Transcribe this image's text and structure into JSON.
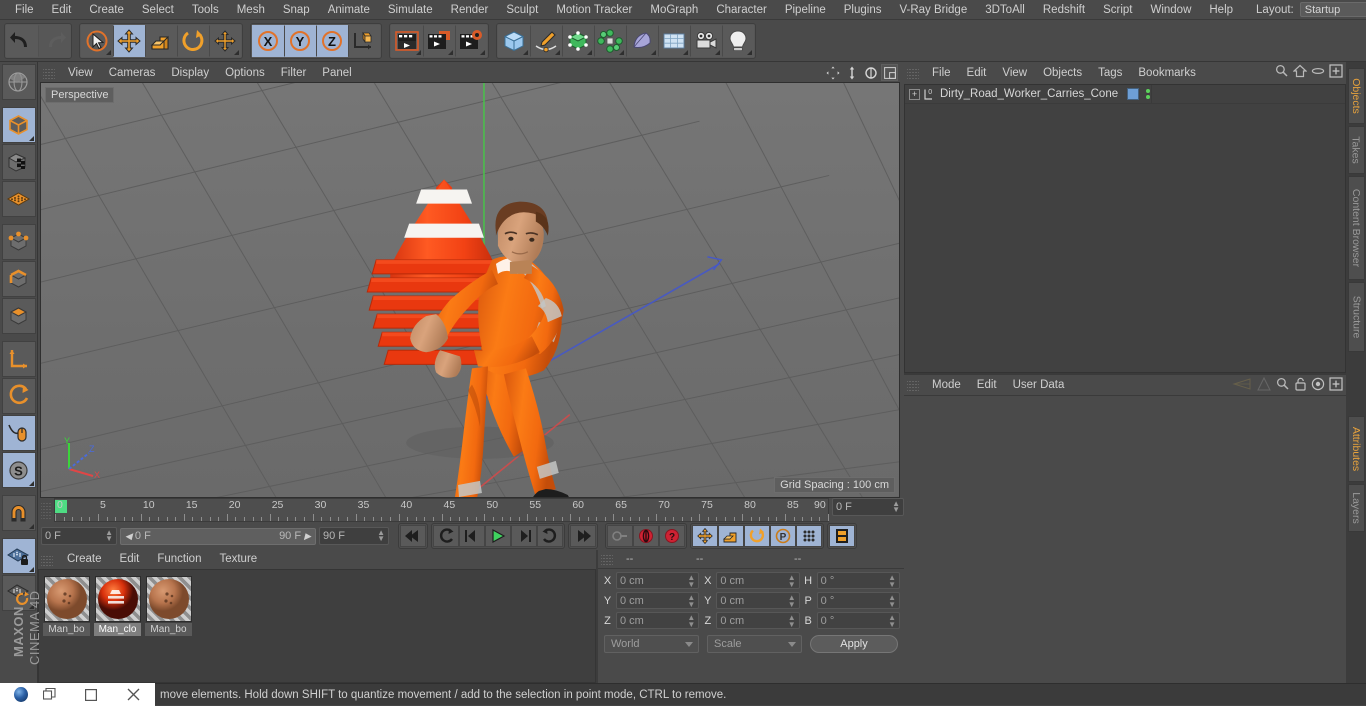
{
  "menubar": {
    "items": [
      "File",
      "Edit",
      "Create",
      "Select",
      "Tools",
      "Mesh",
      "Snap",
      "Animate",
      "Simulate",
      "Render",
      "Sculpt",
      "Motion Tracker",
      "MoGraph",
      "Character",
      "Pipeline",
      "Plugins",
      "V-Ray Bridge",
      "3DToAll",
      "Redshift",
      "Script",
      "Window",
      "Help"
    ],
    "layout_label": "Layout:",
    "layout_value": "Startup"
  },
  "toolbar": {
    "groups": [
      {
        "name": "history",
        "buttons": [
          {
            "icon": "undo-icon",
            "label": "Undo",
            "selected": false,
            "disabled": false
          },
          {
            "icon": "redo-icon",
            "label": "Redo",
            "selected": false,
            "disabled": true
          }
        ]
      },
      {
        "name": "selection-transform",
        "buttons": [
          {
            "icon": "live-selection-icon",
            "label": "Live Selection",
            "selected": false,
            "disabled": false
          },
          {
            "icon": "move-icon",
            "label": "Move",
            "selected": true,
            "disabled": false
          },
          {
            "icon": "scale-icon",
            "label": "Scale",
            "selected": false,
            "disabled": false
          },
          {
            "icon": "rotate-icon",
            "label": "Rotate",
            "selected": false,
            "disabled": false
          },
          {
            "icon": "move-alt-icon",
            "label": "Move Alt",
            "selected": false,
            "disabled": false
          }
        ]
      },
      {
        "name": "axis-locks",
        "buttons": [
          {
            "icon": "axis-x-icon",
            "label": "X",
            "selected": true,
            "disabled": false
          },
          {
            "icon": "axis-y-icon",
            "label": "Y",
            "selected": true,
            "disabled": false
          },
          {
            "icon": "axis-z-icon",
            "label": "Z",
            "selected": true,
            "disabled": false
          },
          {
            "icon": "world-coordinate-icon",
            "label": "World/Object",
            "selected": false,
            "disabled": false
          }
        ]
      },
      {
        "name": "render",
        "buttons": [
          {
            "icon": "render-view-icon",
            "label": "Render View",
            "selected": false,
            "disabled": false
          },
          {
            "icon": "render-region-icon",
            "label": "Render to Picture Viewer",
            "selected": false,
            "disabled": false
          },
          {
            "icon": "render-settings-icon",
            "label": "Edit Render Settings",
            "selected": false,
            "disabled": false
          }
        ]
      },
      {
        "name": "create",
        "buttons": [
          {
            "icon": "cube-primitive-icon",
            "label": "Add Cube Object",
            "selected": false,
            "disabled": false
          },
          {
            "icon": "pen-spline-icon",
            "label": "Add Spline",
            "selected": false,
            "disabled": false
          },
          {
            "icon": "generator-icon",
            "label": "Add Generator",
            "selected": false,
            "disabled": false
          },
          {
            "icon": "deformer-icon",
            "label": "Add Deformer",
            "selected": false,
            "disabled": false
          },
          {
            "icon": "scene-element-icon",
            "label": "Add Scene Element",
            "selected": false,
            "disabled": false
          },
          {
            "icon": "floor-environment-icon",
            "label": "Add Environment",
            "selected": false,
            "disabled": false
          },
          {
            "icon": "camera-icon",
            "label": "Add Camera",
            "selected": false,
            "disabled": false
          },
          {
            "icon": "light-icon",
            "label": "Add Light",
            "selected": false,
            "disabled": false
          }
        ]
      }
    ]
  },
  "left_toolbar": {
    "buttons": [
      {
        "icon": "make-editable-icon",
        "label": "Make Editable",
        "selected": false
      },
      {
        "icon": "model-mode-icon",
        "label": "Model Mode",
        "selected": true
      },
      {
        "icon": "texture-mode-icon",
        "label": "Texture Mode",
        "selected": false
      },
      {
        "icon": "workplane-icon",
        "label": "Workplane",
        "selected": false
      },
      {
        "icon": "points-mode-icon",
        "label": "Points",
        "selected": false
      },
      {
        "icon": "edges-mode-icon",
        "label": "Edges",
        "selected": false
      },
      {
        "icon": "polygons-mode-icon",
        "label": "Polygons",
        "selected": false
      },
      {
        "icon": "axis-modify-icon",
        "label": "Enable Axis Modification",
        "selected": false
      },
      {
        "icon": "viewport-solo-icon",
        "label": "Viewport Solo",
        "selected": false
      },
      {
        "icon": "mouse-tool-icon",
        "label": "Enable Snapping",
        "selected": true
      },
      {
        "icon": "snap-settings-icon",
        "label": "Snap Settings",
        "selected": true
      },
      {
        "icon": "magnet-icon",
        "label": "Magnet",
        "selected": false
      },
      {
        "icon": "workplane-lock-icon",
        "label": "Lock Workplane",
        "selected": true
      },
      {
        "icon": "workplane-rotate-icon",
        "label": "Planar Workplane",
        "selected": false
      }
    ],
    "brand_line1": "MAXON",
    "brand_line2": "CINEMA 4D"
  },
  "viewport": {
    "menu_items": [
      "View",
      "Cameras",
      "Display",
      "Options",
      "Filter",
      "Panel"
    ],
    "label": "Perspective",
    "grid_spacing": "Grid Spacing : 100 cm",
    "axis_labels": {
      "x": "X",
      "y": "Y",
      "z": "Z"
    },
    "controls": [
      {
        "icon": "pan-viewport-icon",
        "label": "Move Camera"
      },
      {
        "icon": "zoom-viewport-icon",
        "label": "Dolly Camera"
      },
      {
        "icon": "rotate-viewport-icon",
        "label": "Rotate Camera"
      },
      {
        "icon": "maximize-viewport-icon",
        "label": "Toggle Active View"
      }
    ]
  },
  "timeline": {
    "ticks": [
      0,
      5,
      10,
      15,
      20,
      25,
      30,
      35,
      40,
      45,
      50,
      55,
      60,
      65,
      70,
      75,
      80,
      85,
      90
    ],
    "current_frame_field": "0 F",
    "start_frame": "0 F",
    "slider_left": "0 F",
    "slider_right": "90 F",
    "end_frame": "90 F"
  },
  "animbar": {
    "transport": [
      {
        "icon": "goto-start-icon",
        "label": "Go To Start"
      },
      {
        "icon": "prev-key-icon",
        "label": "Go To Previous Key"
      },
      {
        "icon": "step-back-icon",
        "label": "Go To Previous Frame"
      },
      {
        "icon": "play-icon",
        "label": "Play Forwards"
      },
      {
        "icon": "step-forward-icon",
        "label": "Go To Next Frame"
      },
      {
        "icon": "next-key-icon",
        "label": "Go To Next Key"
      },
      {
        "icon": "goto-end-icon",
        "label": "Go To End"
      }
    ],
    "record_group": [
      {
        "icon": "autokey-icon",
        "label": "Autokeying",
        "selected": false
      },
      {
        "icon": "record-icon",
        "label": "Record Active Objects",
        "selected": false
      },
      {
        "icon": "keyframe-selection-icon",
        "label": "Keyframe Selection",
        "selected": false
      }
    ],
    "param_group": [
      {
        "icon": "record-position-icon",
        "label": "Position",
        "selected": true
      },
      {
        "icon": "record-scale-icon",
        "label": "Scale",
        "selected": true
      },
      {
        "icon": "record-rotation-icon",
        "label": "Rotation",
        "selected": true
      },
      {
        "icon": "record-pla-icon",
        "label": "Parameter / PLA",
        "selected": true
      },
      {
        "icon": "point-level-anim-icon",
        "label": "Point Level Animation",
        "selected": true
      }
    ],
    "end_button": {
      "icon": "timeline-strip-icon",
      "label": "Animation Mode",
      "selected": true
    }
  },
  "materials": {
    "menu_items": [
      "Create",
      "Edit",
      "Function",
      "Texture"
    ],
    "items": [
      {
        "name": "Man_bo",
        "selected": false,
        "swatch": "skin"
      },
      {
        "name": "Man_clo",
        "selected": true,
        "swatch": "orange"
      },
      {
        "name": "Man_bo",
        "selected": false,
        "swatch": "skin"
      }
    ]
  },
  "coordinates": {
    "headers": [
      "--",
      "--",
      "--"
    ],
    "rows": [
      {
        "pos_label": "X",
        "pos_value": "0 cm",
        "size_label": "X",
        "size_value": "0 cm",
        "rot_label": "H",
        "rot_value": "0 °"
      },
      {
        "pos_label": "Y",
        "pos_value": "0 cm",
        "size_label": "Y",
        "size_value": "0 cm",
        "rot_label": "P",
        "rot_value": "0 °"
      },
      {
        "pos_label": "Z",
        "pos_value": "0 cm",
        "size_label": "Z",
        "size_value": "0 cm",
        "rot_label": "B",
        "rot_value": "0 °"
      }
    ],
    "system_select": "World",
    "mode_select": "Scale",
    "apply_label": "Apply"
  },
  "object_manager": {
    "menu_items": [
      "File",
      "Edit",
      "View",
      "Objects",
      "Tags",
      "Bookmarks"
    ],
    "right_icons": [
      "search-icon",
      "home-icon",
      "eye-icon",
      "plus-box-icon"
    ],
    "rows": [
      {
        "name": "Dirty_Road_Worker_Carries_Cone",
        "expander": "+",
        "type_icon": "null-object-icon",
        "tag": "material-tag",
        "visibility_dots": 2
      }
    ]
  },
  "attribute_manager": {
    "menu_items": [
      "Mode",
      "Edit",
      "User Data"
    ],
    "right_icons": [
      "prev-attr-icon",
      "next-attr-icon",
      "search-icon",
      "lock-icon",
      "target-icon",
      "plus-box-icon"
    ]
  },
  "right_tabs": {
    "top": [
      {
        "label": "Objects",
        "active": true
      },
      {
        "label": "Takes",
        "active": false
      },
      {
        "label": "Content Browser",
        "active": false
      },
      {
        "label": "Structure",
        "active": false
      }
    ],
    "bottom": [
      {
        "label": "Attributes",
        "active": true
      },
      {
        "label": "Layers",
        "active": false
      }
    ]
  },
  "statusbar": {
    "text": "move elements. Hold down SHIFT to quantize movement / add to the selection in point mode, CTRL to remove."
  },
  "window_controls": {
    "minimize": "▭",
    "maximize": "▭",
    "close": "✕"
  }
}
